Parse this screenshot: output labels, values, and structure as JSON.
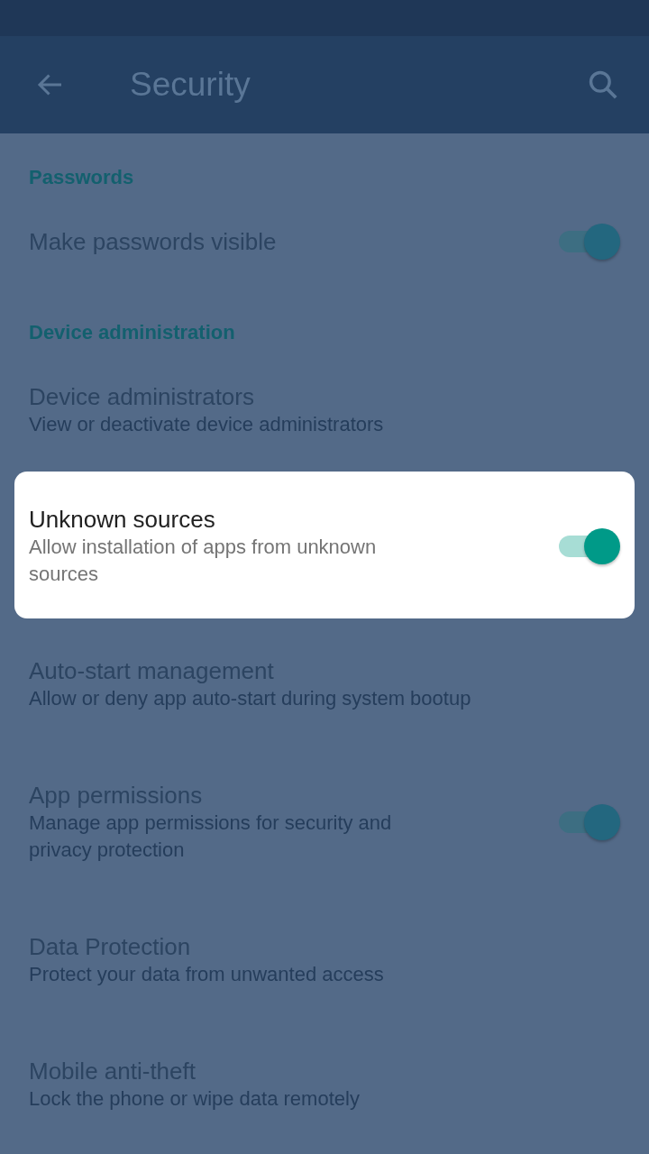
{
  "toolbar": {
    "title": "Security"
  },
  "items": [
    {
      "kind": "header",
      "title": "Passwords"
    },
    {
      "kind": "setting",
      "title": "Make passwords visible",
      "highlighted": false,
      "toggle": {
        "on": true
      }
    },
    {
      "kind": "header",
      "title": "Device administration"
    },
    {
      "kind": "setting",
      "title": "Device administrators",
      "subtitle": "View or deactivate device administrators",
      "highlighted": false
    },
    {
      "kind": "setting",
      "title": "Unknown sources",
      "subtitle": "Allow installation of apps from unknown sources",
      "highlighted": true,
      "toggle": {
        "on": true
      }
    },
    {
      "kind": "setting",
      "title": "Auto-start management",
      "subtitle": "Allow or deny app auto-start during system bootup",
      "highlighted": false
    },
    {
      "kind": "setting",
      "title": "App permissions",
      "subtitle": "Manage app permissions for security and privacy protection",
      "highlighted": false,
      "toggle": {
        "on": true
      }
    },
    {
      "kind": "setting",
      "title": "Data Protection",
      "subtitle": "Protect your data from unwanted access",
      "highlighted": false
    },
    {
      "kind": "setting",
      "title": "Mobile anti-theft",
      "subtitle": "Lock the phone or wipe data remotely",
      "highlighted": false
    }
  ]
}
